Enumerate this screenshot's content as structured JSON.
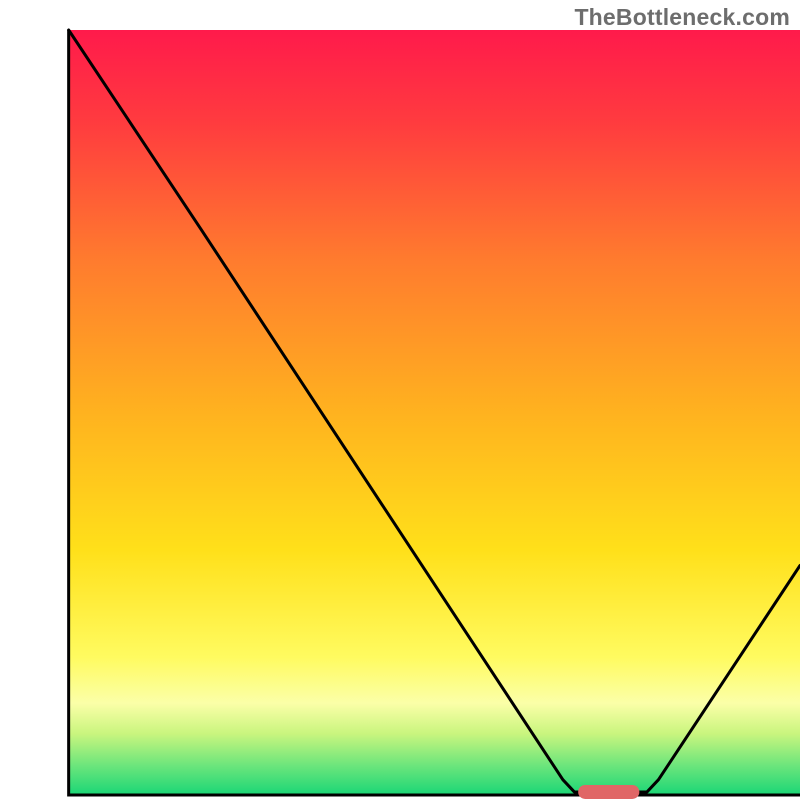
{
  "watermark": {
    "text": "TheBottleneck.com"
  },
  "chart_data": {
    "type": "line",
    "title": "",
    "xlabel": "",
    "ylabel": "",
    "xlim": [
      0,
      1
    ],
    "ylim": [
      0,
      1
    ],
    "curve": [
      {
        "x": 0.044,
        "y": 1.0
      },
      {
        "x": 0.218,
        "y": 0.738
      },
      {
        "x": 0.69,
        "y": 0.02
      },
      {
        "x": 0.705,
        "y": 0.004
      },
      {
        "x": 0.8,
        "y": 0.004
      },
      {
        "x": 0.815,
        "y": 0.02
      },
      {
        "x": 1.0,
        "y": 0.3
      }
    ],
    "marker": {
      "x0": 0.71,
      "x1": 0.79,
      "y": 0.004,
      "color": "#e06666"
    },
    "frame": {
      "x0": 0.044,
      "y0": 0.0,
      "x1": 1.0,
      "y1": 1.0,
      "color": "#000000",
      "weight": 3
    },
    "gradient_stops": [
      {
        "offset": 0.0,
        "color": "#ff1a4b"
      },
      {
        "offset": 0.12,
        "color": "#ff3b3f"
      },
      {
        "offset": 0.3,
        "color": "#ff7b2e"
      },
      {
        "offset": 0.5,
        "color": "#ffb21f"
      },
      {
        "offset": 0.68,
        "color": "#ffe01a"
      },
      {
        "offset": 0.82,
        "color": "#fffb60"
      },
      {
        "offset": 0.88,
        "color": "#fbffa8"
      },
      {
        "offset": 0.92,
        "color": "#c9f57e"
      },
      {
        "offset": 0.96,
        "color": "#6fe67c"
      },
      {
        "offset": 1.0,
        "color": "#1ad676"
      }
    ]
  }
}
